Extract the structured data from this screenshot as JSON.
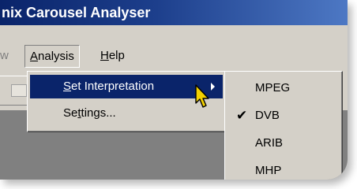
{
  "window": {
    "title": "nix Carousel Analyser"
  },
  "menubar": {
    "view_fragment": "w",
    "analysis": {
      "underline": "A",
      "rest": "nalysis"
    },
    "help": {
      "underline": "H",
      "rest": "elp"
    }
  },
  "analysis_menu": {
    "set_interpretation": {
      "underline": "S",
      "rest": "et Interpretation"
    },
    "settings": {
      "before": "Se",
      "underline": "t",
      "after": "tings..."
    }
  },
  "interpretation_menu": {
    "options": [
      "MPEG",
      "DVB",
      "ARIB",
      "MHP"
    ],
    "checked": "DVB"
  },
  "colors": {
    "titlebar_start": "#0a246a",
    "titlebar_end": "#4d78c4",
    "face": "#d4d0c8",
    "highlight": "#0a246a",
    "cursor_fill": "#f2d000"
  }
}
